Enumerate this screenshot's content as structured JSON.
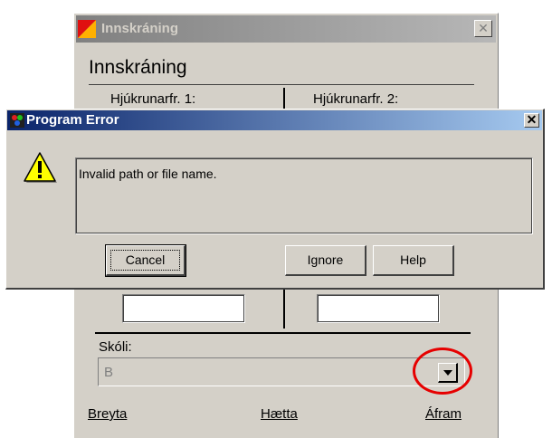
{
  "background_window": {
    "title": "Innskráning",
    "heading": "Innskráning",
    "nurse1_label": "Hjúkrunarfr. 1:",
    "nurse2_label": "Hjúkrunarfr. 2:",
    "school_label": "Skóli:",
    "school_value": "B",
    "links": {
      "change": "Breyta",
      "cancel": "Hætta",
      "continue": "Áfram"
    },
    "close_glyph": "✕"
  },
  "error_dialog": {
    "title": "Program Error",
    "message": "Invalid path or file name.",
    "buttons": {
      "cancel": "Cancel",
      "ignore": "Ignore",
      "help": "Help"
    },
    "close_glyph": "✕",
    "icon": "warning-icon"
  },
  "annotation": {
    "highlight": "red-circle",
    "color": "#e60000"
  }
}
